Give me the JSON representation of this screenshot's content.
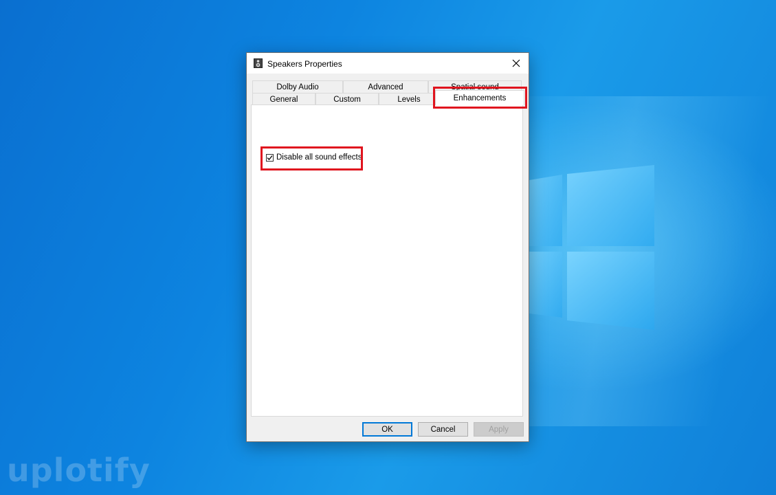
{
  "window": {
    "title": "Speakers Properties",
    "close_glyph": "✕"
  },
  "tabs": {
    "row_back": [
      "Dolby Audio",
      "Advanced",
      "Spatial sound"
    ],
    "row_front": [
      "General",
      "Custom",
      "Levels",
      "Enhancements"
    ],
    "active": "Enhancements"
  },
  "enhancements": {
    "disable_all_label": "Disable all sound effects",
    "disable_all_checked": true
  },
  "buttons": {
    "ok": "OK",
    "cancel": "Cancel",
    "apply": "Apply"
  },
  "watermark": "uplotify",
  "colors": {
    "highlight": "#e0141e",
    "accent": "#0078d7"
  }
}
